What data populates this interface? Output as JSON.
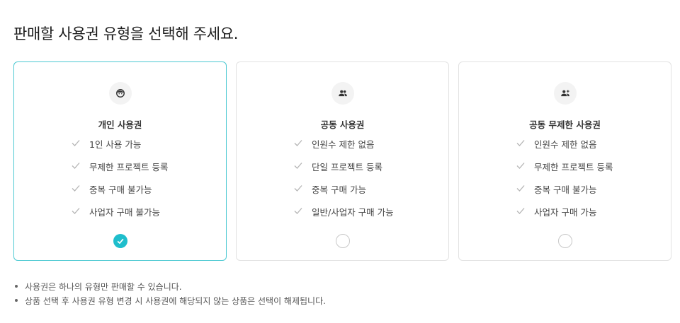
{
  "page": {
    "title": "판매할 사용권 유형을 선택해 주세요."
  },
  "cards": [
    {
      "title": "개인 사용권",
      "icon": "person-face-icon",
      "selected": true,
      "features": [
        "1인 사용 가능",
        "무제한 프로젝트 등록",
        "중복 구매 불가능",
        "사업자 구매 불가능"
      ]
    },
    {
      "title": "공동 사용권",
      "icon": "group-icon",
      "selected": false,
      "features": [
        "인원수 제한 없음",
        "단일 프로젝트 등록",
        "중복 구매 가능",
        "일반/사업자 구매 가능"
      ]
    },
    {
      "title": "공동 무제한 사용권",
      "icon": "group-add-icon",
      "selected": false,
      "features": [
        "인원수 제한 없음",
        "무제한 프로젝트 등록",
        "중복 구매 불가능",
        "사업자 구매 가능"
      ]
    }
  ],
  "notes": [
    "사용권은 하나의 유형만 판매할 수 있습니다.",
    "상품 선택 후 사용권 유형 변경 시 사용권에 해당되지 않는 상품은 선택이 해제됩니다."
  ],
  "colors": {
    "accent": "#1fbecc",
    "selected_border": "#4cc9d2",
    "card_border": "#e2e2e2",
    "check_icon": "#b5b5b5"
  }
}
